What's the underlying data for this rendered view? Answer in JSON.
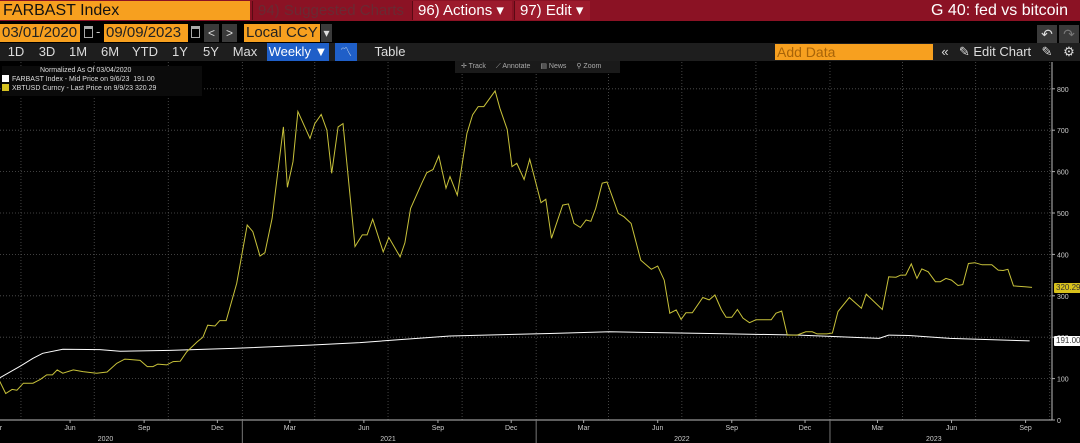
{
  "header": {
    "security": "FARBAST Index",
    "suggested": "94) Suggested Charts",
    "actions": "96) Actions ▾",
    "edit": "97) Edit ▾",
    "title": "G 40: fed vs bitcoin"
  },
  "controls": {
    "start_date": "03/01/2020",
    "dash": "-",
    "end_date": "09/09/2023",
    "prev": "<",
    "next": ">",
    "currency": "Local CCY",
    "currency_arrow": "▾",
    "undo": "↶",
    "redo": "↷"
  },
  "periods": [
    "1D",
    "3D",
    "1M",
    "6M",
    "YTD",
    "1Y",
    "5Y",
    "Max"
  ],
  "frequency": "Weekly ▼",
  "chart_type_icon": "line-chart-icon",
  "table_label": "Table",
  "add_data_placeholder": "Add Data",
  "collapse": "«",
  "edit_chart": "✎ Edit Chart",
  "chart_tools": {
    "track": "✛ Track",
    "annotate": "⟋ Annotate",
    "news": "▤ News",
    "zoom": "⚲ Zoom"
  },
  "colors": {
    "accent_orange": "#f7a01f",
    "header_red": "#8b1224",
    "farbast": "#ffffff",
    "xbtusd": "#c8c23a",
    "selected_blue": "#1f5fc8"
  },
  "chart_data": {
    "type": "line",
    "legend_title": "Normalized As Of 03/04/2020",
    "legend_placement": "top-left",
    "grid": true,
    "ylim": [
      0,
      800
    ],
    "yticks": [
      0,
      100,
      200,
      300,
      400,
      500,
      600,
      700,
      800
    ],
    "xlim": [
      "2020-03-01",
      "2023-09-15"
    ],
    "xticks": [
      [
        "2020-03-01",
        "Mar"
      ],
      [
        "2020-06-01",
        "Jun"
      ],
      [
        "2020-09-01",
        "Sep"
      ],
      [
        "2020-12-01",
        "Dec"
      ],
      [
        "2021-03-01",
        "Mar"
      ],
      [
        "2021-06-01",
        "Jun"
      ],
      [
        "2021-09-01",
        "Sep"
      ],
      [
        "2021-12-01",
        "Dec"
      ],
      [
        "2022-03-01",
        "Mar"
      ],
      [
        "2022-06-01",
        "Jun"
      ],
      [
        "2022-09-01",
        "Sep"
      ],
      [
        "2022-12-01",
        "Dec"
      ],
      [
        "2023-03-01",
        "Mar"
      ],
      [
        "2023-06-01",
        "Jun"
      ],
      [
        "2023-09-01",
        "Sep"
      ]
    ],
    "years": [
      "2020",
      "2021",
      "2022",
      "2023"
    ],
    "series": [
      {
        "name": "FARBAST Index - Mid Price on 9/6/23",
        "last": "191.00",
        "color": "#ffffff",
        "points": [
          [
            "2020-03-04",
            100
          ],
          [
            "2020-03-31",
            130
          ],
          [
            "2020-04-16",
            149
          ],
          [
            "2020-04-28",
            161
          ],
          [
            "2020-05-23",
            171
          ],
          [
            "2020-07-08",
            170
          ],
          [
            "2020-08-02",
            166
          ],
          [
            "2020-10-03",
            168
          ],
          [
            "2020-12-20",
            173
          ],
          [
            "2021-03-26",
            181
          ],
          [
            "2021-05-27",
            187
          ],
          [
            "2021-09-16",
            203
          ],
          [
            "2022-01-18",
            209
          ],
          [
            "2022-04-02",
            213
          ],
          [
            "2022-08-04",
            209
          ],
          [
            "2022-11-24",
            205
          ],
          [
            "2023-03-03",
            197
          ],
          [
            "2023-03-15",
            205
          ],
          [
            "2023-04-09",
            204
          ],
          [
            "2023-05-30",
            197
          ],
          [
            "2023-09-06",
            191
          ]
        ]
      },
      {
        "name": "XBTUSD Curncy - Last Price on 9/9/23",
        "last": "320.29",
        "color": "#c8c23a",
        "points": [
          [
            "2020-03-04",
            100
          ],
          [
            "2020-03-13",
            64
          ],
          [
            "2020-03-21",
            74
          ],
          [
            "2020-03-27",
            72
          ],
          [
            "2020-04-04",
            89
          ],
          [
            "2020-04-16",
            89
          ],
          [
            "2020-04-25",
            98
          ],
          [
            "2020-05-03",
            109
          ],
          [
            "2020-05-10",
            109
          ],
          [
            "2020-05-16",
            121
          ],
          [
            "2020-05-23",
            113
          ],
          [
            "2020-06-05",
            121
          ],
          [
            "2020-06-17",
            117
          ],
          [
            "2020-07-04",
            113
          ],
          [
            "2020-07-17",
            116
          ],
          [
            "2020-07-29",
            137
          ],
          [
            "2020-08-08",
            147
          ],
          [
            "2020-08-27",
            144
          ],
          [
            "2020-09-05",
            129
          ],
          [
            "2020-09-12",
            129
          ],
          [
            "2020-09-18",
            135
          ],
          [
            "2020-09-29",
            133
          ],
          [
            "2020-10-07",
            141
          ],
          [
            "2020-10-16",
            142
          ],
          [
            "2020-10-24",
            165
          ],
          [
            "2020-11-06",
            189
          ],
          [
            "2020-11-13",
            200
          ],
          [
            "2020-11-19",
            229
          ],
          [
            "2020-11-28",
            227
          ],
          [
            "2020-12-04",
            240
          ],
          [
            "2020-12-12",
            240
          ],
          [
            "2020-12-25",
            330
          ],
          [
            "2021-01-07",
            471
          ],
          [
            "2021-01-14",
            455
          ],
          [
            "2021-01-23",
            396
          ],
          [
            "2021-01-29",
            404
          ],
          [
            "2021-02-07",
            487
          ],
          [
            "2021-02-21",
            708
          ],
          [
            "2021-02-26",
            562
          ],
          [
            "2021-03-05",
            624
          ],
          [
            "2021-03-11",
            745
          ],
          [
            "2021-03-26",
            680
          ],
          [
            "2021-04-01",
            716
          ],
          [
            "2021-04-09",
            738
          ],
          [
            "2021-04-16",
            700
          ],
          [
            "2021-04-22",
            596
          ],
          [
            "2021-04-30",
            708
          ],
          [
            "2021-05-06",
            716
          ],
          [
            "2021-05-21",
            419
          ],
          [
            "2021-05-30",
            447
          ],
          [
            "2021-06-05",
            447
          ],
          [
            "2021-06-12",
            485
          ],
          [
            "2021-06-25",
            406
          ],
          [
            "2021-07-02",
            441
          ],
          [
            "2021-07-16",
            394
          ],
          [
            "2021-07-22",
            428
          ],
          [
            "2021-07-29",
            511
          ],
          [
            "2021-08-12",
            572
          ],
          [
            "2021-08-18",
            597
          ],
          [
            "2021-08-26",
            605
          ],
          [
            "2021-09-02",
            638
          ],
          [
            "2021-09-11",
            560
          ],
          [
            "2021-09-16",
            588
          ],
          [
            "2021-09-25",
            543
          ],
          [
            "2021-10-07",
            692
          ],
          [
            "2021-10-14",
            737
          ],
          [
            "2021-10-21",
            757
          ],
          [
            "2021-10-28",
            757
          ],
          [
            "2021-11-11",
            795
          ],
          [
            "2021-11-17",
            753
          ],
          [
            "2021-11-26",
            702
          ],
          [
            "2021-12-02",
            612
          ],
          [
            "2021-12-08",
            620
          ],
          [
            "2021-12-17",
            581
          ],
          [
            "2021-12-24",
            630
          ],
          [
            "2022-01-07",
            525
          ],
          [
            "2022-01-13",
            533
          ],
          [
            "2022-01-20",
            439
          ],
          [
            "2022-02-03",
            519
          ],
          [
            "2022-02-10",
            522
          ],
          [
            "2022-02-17",
            475
          ],
          [
            "2022-02-25",
            465
          ],
          [
            "2022-03-04",
            483
          ],
          [
            "2022-03-10",
            480
          ],
          [
            "2022-03-16",
            511
          ],
          [
            "2022-03-24",
            572
          ],
          [
            "2022-03-30",
            575
          ],
          [
            "2022-04-13",
            499
          ],
          [
            "2022-04-20",
            491
          ],
          [
            "2022-04-29",
            475
          ],
          [
            "2022-05-11",
            386
          ],
          [
            "2022-05-24",
            364
          ],
          [
            "2022-06-01",
            372
          ],
          [
            "2022-06-09",
            338
          ],
          [
            "2022-06-16",
            258
          ],
          [
            "2022-06-24",
            266
          ],
          [
            "2022-06-30",
            243
          ],
          [
            "2022-07-06",
            259
          ],
          [
            "2022-07-14",
            259
          ],
          [
            "2022-07-27",
            296
          ],
          [
            "2022-08-04",
            290
          ],
          [
            "2022-08-11",
            302
          ],
          [
            "2022-08-19",
            267
          ],
          [
            "2022-08-25",
            248
          ],
          [
            "2022-09-01",
            248
          ],
          [
            "2022-09-08",
            267
          ],
          [
            "2022-09-15",
            246
          ],
          [
            "2022-09-23",
            235
          ],
          [
            "2022-10-01",
            242
          ],
          [
            "2022-10-20",
            242
          ],
          [
            "2022-10-26",
            258
          ],
          [
            "2022-11-02",
            263
          ],
          [
            "2022-11-09",
            205
          ],
          [
            "2022-11-21",
            205
          ],
          [
            "2022-12-02",
            213
          ],
          [
            "2022-12-10",
            213
          ],
          [
            "2022-12-16",
            208
          ],
          [
            "2022-12-28",
            208
          ],
          [
            "2023-01-04",
            210
          ],
          [
            "2023-01-11",
            262
          ],
          [
            "2023-01-25",
            296
          ],
          [
            "2023-02-09",
            270
          ],
          [
            "2023-02-15",
            304
          ],
          [
            "2023-03-07",
            267
          ],
          [
            "2023-03-15",
            346
          ],
          [
            "2023-03-24",
            345
          ],
          [
            "2023-03-30",
            350
          ],
          [
            "2023-04-05",
            350
          ],
          [
            "2023-04-12",
            377
          ],
          [
            "2023-04-19",
            342
          ],
          [
            "2023-04-25",
            365
          ],
          [
            "2023-05-03",
            358
          ],
          [
            "2023-05-12",
            334
          ],
          [
            "2023-05-18",
            334
          ],
          [
            "2023-05-25",
            342
          ],
          [
            "2023-06-01",
            338
          ],
          [
            "2023-06-09",
            325
          ],
          [
            "2023-06-15",
            327
          ],
          [
            "2023-06-22",
            378
          ],
          [
            "2023-06-30",
            380
          ],
          [
            "2023-07-09",
            375
          ],
          [
            "2023-07-21",
            375
          ],
          [
            "2023-07-29",
            362
          ],
          [
            "2023-08-04",
            361
          ],
          [
            "2023-08-10",
            364
          ],
          [
            "2023-08-17",
            324
          ],
          [
            "2023-08-31",
            322
          ],
          [
            "2023-09-09",
            320.29
          ]
        ]
      }
    ]
  }
}
